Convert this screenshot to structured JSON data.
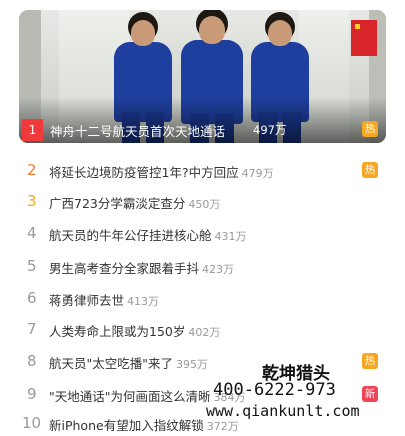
{
  "hero": {
    "rank": "1",
    "title": "神舟十二号航天员首次天地通话",
    "count": "497万",
    "badge": "热",
    "badge_color": "#f5a623"
  },
  "colors": {
    "rank_1": "#f0393a",
    "rank_2": "#f57b2c",
    "rank_3": "#f5a623",
    "rank_default": "#999999",
    "hot": "#f5a623",
    "new": "#ee4455"
  },
  "items": [
    {
      "rank": "2",
      "title": "将延长边境防疫管控1年?中方回应",
      "count": "479万",
      "badge": "热"
    },
    {
      "rank": "3",
      "title": "广西723分学霸淡定查分",
      "count": "450万",
      "badge": ""
    },
    {
      "rank": "4",
      "title": "航天员的牛年公仔挂进核心舱",
      "count": "431万",
      "badge": ""
    },
    {
      "rank": "5",
      "title": "男生高考查分全家跟着手抖",
      "count": "423万",
      "badge": ""
    },
    {
      "rank": "6",
      "title": "蒋勇律师去世",
      "count": "413万",
      "badge": ""
    },
    {
      "rank": "7",
      "title": "人类寿命上限或为150岁",
      "count": "402万",
      "badge": ""
    },
    {
      "rank": "8",
      "title": "航天员\"太空吃播\"来了",
      "count": "395万",
      "badge": "热"
    },
    {
      "rank": "9",
      "title": "\"天地通话\"为何画面这么清晰",
      "count": "384万",
      "badge": "新"
    },
    {
      "rank": "10",
      "title": "新iPhone有望加入指纹解锁",
      "count": "372万",
      "badge": ""
    }
  ],
  "watermark": {
    "name": "乾坤猎头",
    "phone": "400-6222-973",
    "url": "www.qiankunlt.com"
  }
}
